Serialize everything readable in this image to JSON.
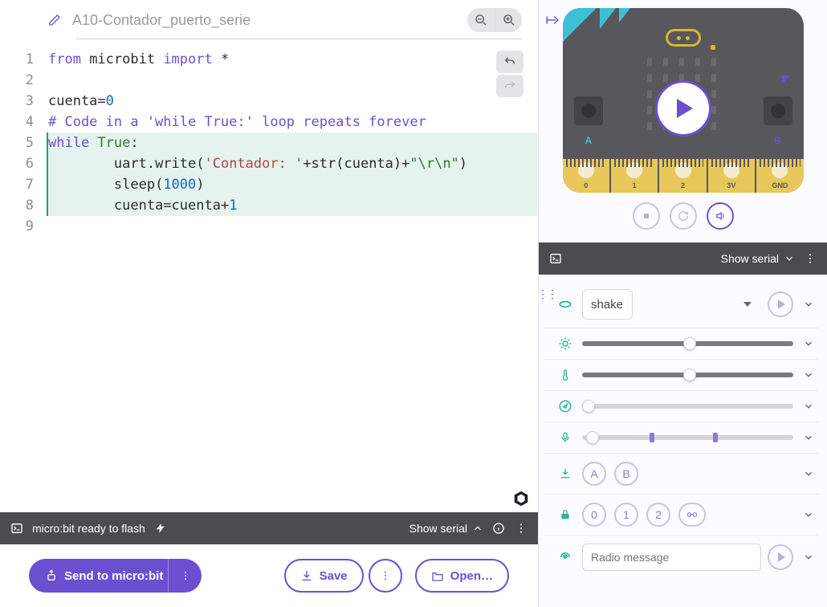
{
  "title": "A10-Contador_puerto_serie",
  "code": {
    "lines": [
      {
        "n": 1,
        "hl": false,
        "segs": [
          [
            "from ",
            "kw"
          ],
          [
            "microbit ",
            ""
          ],
          [
            "import ",
            "kw"
          ],
          [
            "*",
            ""
          ]
        ]
      },
      {
        "n": 2,
        "hl": false,
        "segs": [
          [
            "",
            ""
          ]
        ]
      },
      {
        "n": 3,
        "hl": false,
        "segs": [
          [
            "cuenta=",
            ""
          ],
          [
            "0",
            "num"
          ]
        ]
      },
      {
        "n": 4,
        "hl": false,
        "segs": [
          [
            "# Code in a 'while True:' loop repeats forever",
            "com"
          ]
        ]
      },
      {
        "n": 5,
        "hl": true,
        "segs": [
          [
            "while ",
            "kw"
          ],
          [
            "True",
            "bool"
          ],
          [
            ":",
            ""
          ]
        ]
      },
      {
        "n": 6,
        "hl": true,
        "indent": 2,
        "segs": [
          [
            "uart.write(",
            ""
          ],
          [
            "'Contador: '",
            "str"
          ],
          [
            "+str(cuenta)+",
            ""
          ],
          [
            "\"\\r\\n\"",
            "strg"
          ],
          [
            ")",
            ""
          ]
        ]
      },
      {
        "n": 7,
        "hl": true,
        "indent": 2,
        "segs": [
          [
            "sleep(",
            ""
          ],
          [
            "1000",
            "num"
          ],
          [
            ")",
            ""
          ]
        ]
      },
      {
        "n": 8,
        "hl": true,
        "indent": 2,
        "segs": [
          [
            "cuenta=cuenta+",
            ""
          ],
          [
            "1",
            "num"
          ]
        ]
      },
      {
        "n": 9,
        "hl": false,
        "segs": [
          [
            "",
            ""
          ]
        ]
      }
    ]
  },
  "status": {
    "text": "micro:bit ready to flash",
    "show_serial": "Show serial"
  },
  "actions": {
    "send": "Send to micro:bit",
    "save": "Save",
    "open": "Open…"
  },
  "board": {
    "pins": [
      "0",
      "1",
      "2",
      "3V",
      "GND"
    ],
    "labA": "A",
    "labB": "B"
  },
  "sim_serial": {
    "label": "Show serial"
  },
  "sensors": {
    "gesture": {
      "value": "shake"
    },
    "light": {
      "pct": 48
    },
    "temp": {
      "pct": 48
    },
    "compass": {
      "pct": 0
    },
    "sound": {
      "pct": 2,
      "marks": [
        32,
        62
      ]
    },
    "buttons": {
      "a": "A",
      "b": "B"
    },
    "pins": {
      "items": [
        "0",
        "1",
        "2"
      ]
    },
    "radio": {
      "placeholder": "Radio message"
    }
  }
}
